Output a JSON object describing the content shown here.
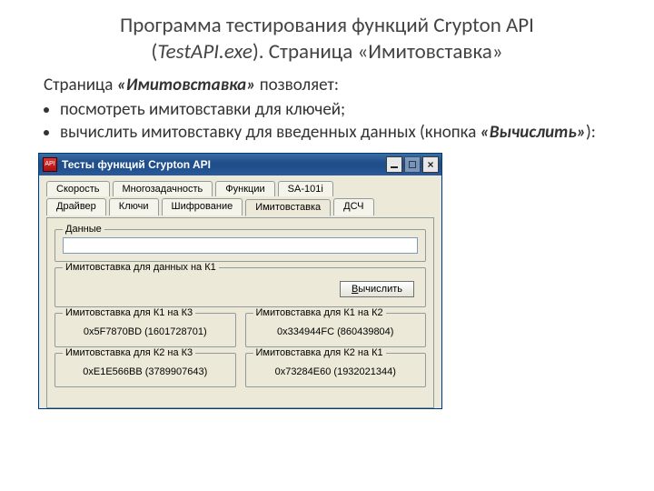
{
  "slide": {
    "title_l1": "Программа тестирования функций Crypton API",
    "title_l2a": "(",
    "title_l2b": "TestAPI.exe",
    "title_l2c": "). Страница «Имитовставка»",
    "intro_pre": "Страница ",
    "intro_bold": "«Имитовставка»",
    "intro_post": " позволяет:",
    "bullet1": " посмотреть имитовставки для ключей;",
    "bullet2_pre": "вычислить имитовставку для введенных данных (кнопка ",
    "bullet2_bold": "«Вычислить»",
    "bullet2_post": "):"
  },
  "window": {
    "title": "Тесты функций Crypton API",
    "tabs_row1": [
      "Скорость",
      "Многозадачность",
      "Функции",
      "SA-101i"
    ],
    "tabs_row2": [
      "Драйвер",
      "Ключи",
      "Шифрование",
      "Имитовставка",
      "ДСЧ"
    ],
    "active_tab": "Имитовставка",
    "group_data": "Данные",
    "group_imito_k1": "Имитовставка для данных на К1",
    "btn_calc_pre": "В",
    "btn_calc_rest": "ычислить",
    "groups": {
      "k1_on_k3": {
        "label": "Имитовставка для К1 на К3",
        "value": "0x5F7870BD (1601728701)"
      },
      "k1_on_k2": {
        "label": "Имитовставка для К1 на К2",
        "value": "0x334944FC (860439804)"
      },
      "k2_on_k3": {
        "label": "Имитовставка для К2 на К3",
        "value": "0xE1E566BB (3789907643)"
      },
      "k2_on_k1": {
        "label": "Имитовставка для К2 на К1",
        "value": "0x73284E60 (1932021344)"
      }
    },
    "input_value": ""
  }
}
